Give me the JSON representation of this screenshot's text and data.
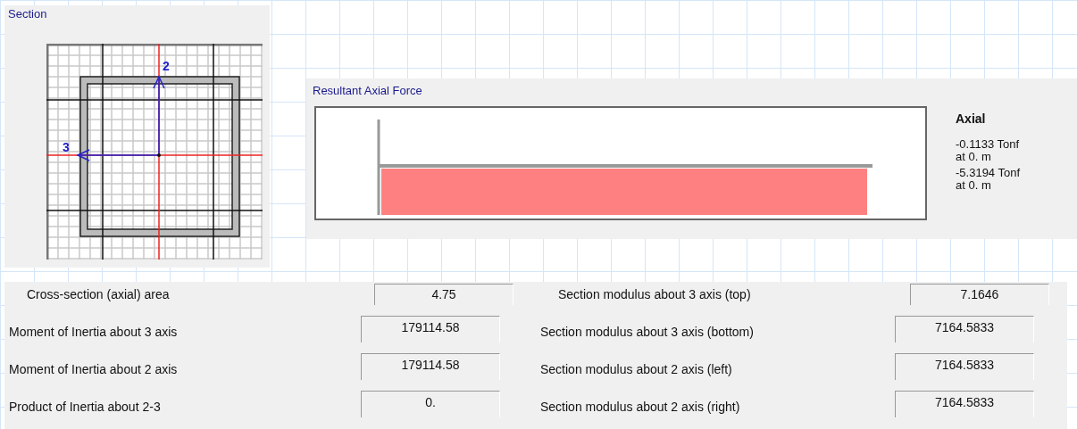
{
  "section": {
    "title": "Section",
    "axis_2": "2",
    "axis_3": "3"
  },
  "axial_force": {
    "title": "Resultant Axial Force",
    "legend_title": "Axial",
    "readings": [
      {
        "value": "-0.1133 Tonf",
        "location": "at 0. m"
      },
      {
        "value": "-5.3194 Tonf",
        "location": "at 0. m"
      }
    ]
  },
  "properties": {
    "left": [
      {
        "label": "Cross-section (axial) area",
        "value": "4.75"
      },
      {
        "label": "Moment of Inertia about 3 axis",
        "value": "179114.58"
      },
      {
        "label": "Moment of Inertia about 2 axis",
        "value": "179114.58"
      },
      {
        "label": "Product of Inertia about 2-3",
        "value": "0."
      }
    ],
    "right": [
      {
        "label": "Section modulus about 3 axis (top)",
        "value": "7.1646"
      },
      {
        "label": "Section modulus about 3 axis (bottom)",
        "value": "7164.5833"
      },
      {
        "label": "Section modulus about 2 axis (left)",
        "value": "7164.5833"
      },
      {
        "label": "Section modulus about 2 axis (right)",
        "value": "7164.5833"
      }
    ]
  }
}
